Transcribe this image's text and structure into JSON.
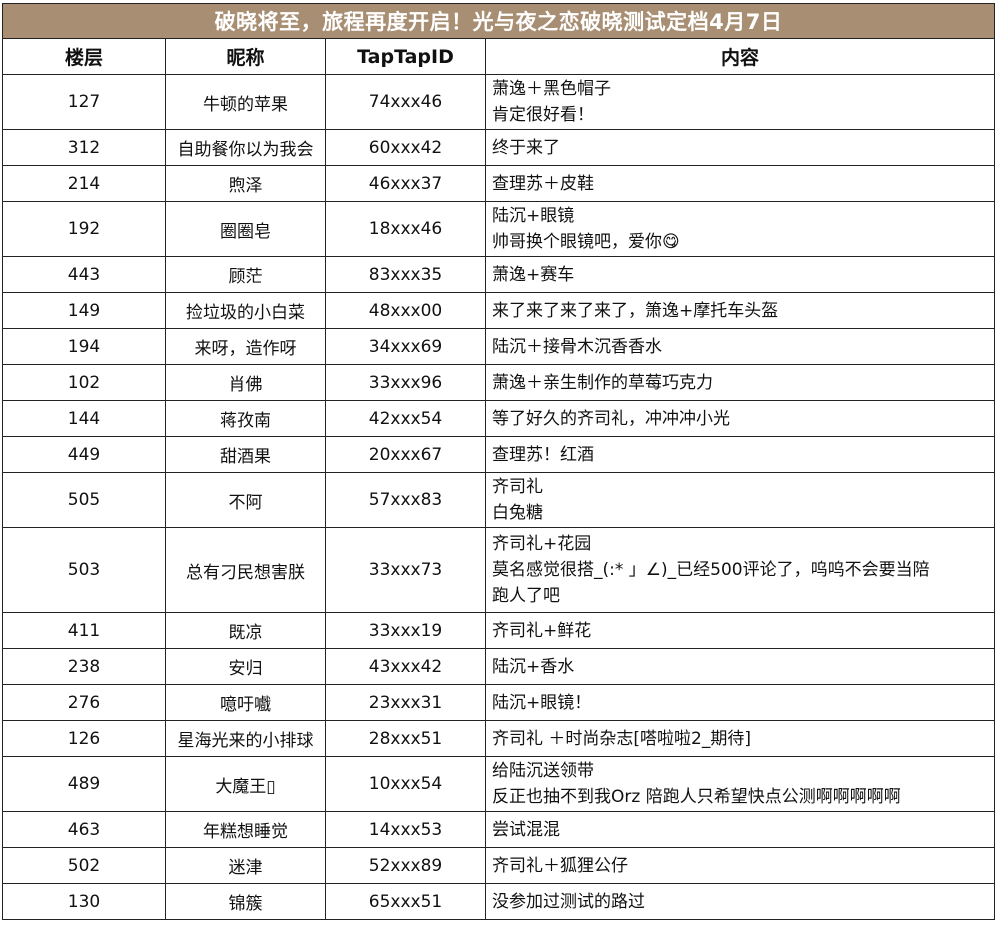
{
  "title": "破晓将至，旅程再度开启！光与夜之恋破晓测试定档4月7日",
  "headers": [
    "楼层",
    "昵称",
    "TapTapID",
    "内容"
  ],
  "rows": [
    {
      "floor": "127",
      "nick": "牛顿的苹果",
      "id": "74xxx46",
      "content": [
        "萧逸＋黑色帽子",
        "肯定很好看！"
      ]
    },
    {
      "floor": "312",
      "nick": "自助餐你以为我会",
      "id": "60xxx42",
      "content": [
        "终于来了"
      ]
    },
    {
      "floor": "214",
      "nick": "煦泽",
      "id": "46xxx37",
      "content": [
        "查理苏＋皮鞋"
      ]
    },
    {
      "floor": "192",
      "nick": "圈圈皂",
      "id": "18xxx46",
      "content": [
        "陆沉+眼镜",
        "帅哥换个眼镜吧，爱你😋"
      ]
    },
    {
      "floor": "443",
      "nick": "顾茫",
      "id": "83xxx35",
      "content": [
        "萧逸+赛车"
      ]
    },
    {
      "floor": "149",
      "nick": "捡垃圾的小白菜",
      "id": "48xxx00",
      "content": [
        "来了来了来了来了，箫逸+摩托车头盔"
      ]
    },
    {
      "floor": "194",
      "nick": "来呀，造作呀",
      "id": "34xxx69",
      "content": [
        "陆沉＋接骨木沉香香水"
      ]
    },
    {
      "floor": "102",
      "nick": "肖佛",
      "id": "33xxx96",
      "content": [
        "萧逸＋亲生制作的草莓巧克力"
      ]
    },
    {
      "floor": "144",
      "nick": "蒋孜南",
      "id": "42xxx54",
      "content": [
        "等了好久的齐司礼，冲冲冲小光"
      ]
    },
    {
      "floor": "449",
      "nick": "甜酒果",
      "id": "20xxx67",
      "content": [
        "查理苏！红酒"
      ]
    },
    {
      "floor": "505",
      "nick": "不阿",
      "id": "57xxx83",
      "content": [
        "齐司礼",
        "白兔糖"
      ]
    },
    {
      "floor": "503",
      "nick": "总有刁民想害朕",
      "id": "33xxx73",
      "content": [
        "齐司礼+花园",
        "莫名感觉很搭_(:* 」∠)_已经500评论了，呜呜不会要当陪",
        "跑人了吧"
      ]
    },
    {
      "floor": "411",
      "nick": "既凉",
      "id": "33xxx19",
      "content": [
        "齐司礼+鲜花"
      ]
    },
    {
      "floor": "238",
      "nick": "安归",
      "id": "43xxx42",
      "content": [
        "陆沉+香水"
      ]
    },
    {
      "floor": "276",
      "nick": "噫吁嚱",
      "id": "23xxx31",
      "content": [
        "陆沉+眼镜！"
      ]
    },
    {
      "floor": "126",
      "nick": "星海光来的小排球",
      "id": "28xxx51",
      "content": [
        "齐司礼 ＋时尚杂志[嗒啦啦2_期待]"
      ]
    },
    {
      "floor": "489",
      "nick": "大魔王▯",
      "id": "10xxx54",
      "content": [
        "给陆沉送领带",
        "反正也抽不到我Orz  陪跑人只希望快点公测啊啊啊啊啊"
      ]
    },
    {
      "floor": "463",
      "nick": "年糕想睡觉",
      "id": "14xxx53",
      "content": [
        "尝试混混"
      ]
    },
    {
      "floor": "502",
      "nick": "迷津",
      "id": "52xxx89",
      "content": [
        "齐司礼＋狐狸公仔"
      ]
    },
    {
      "floor": "130",
      "nick": "锦簇",
      "id": "65xxx51",
      "content": [
        "没参加过测试的路过"
      ]
    }
  ]
}
